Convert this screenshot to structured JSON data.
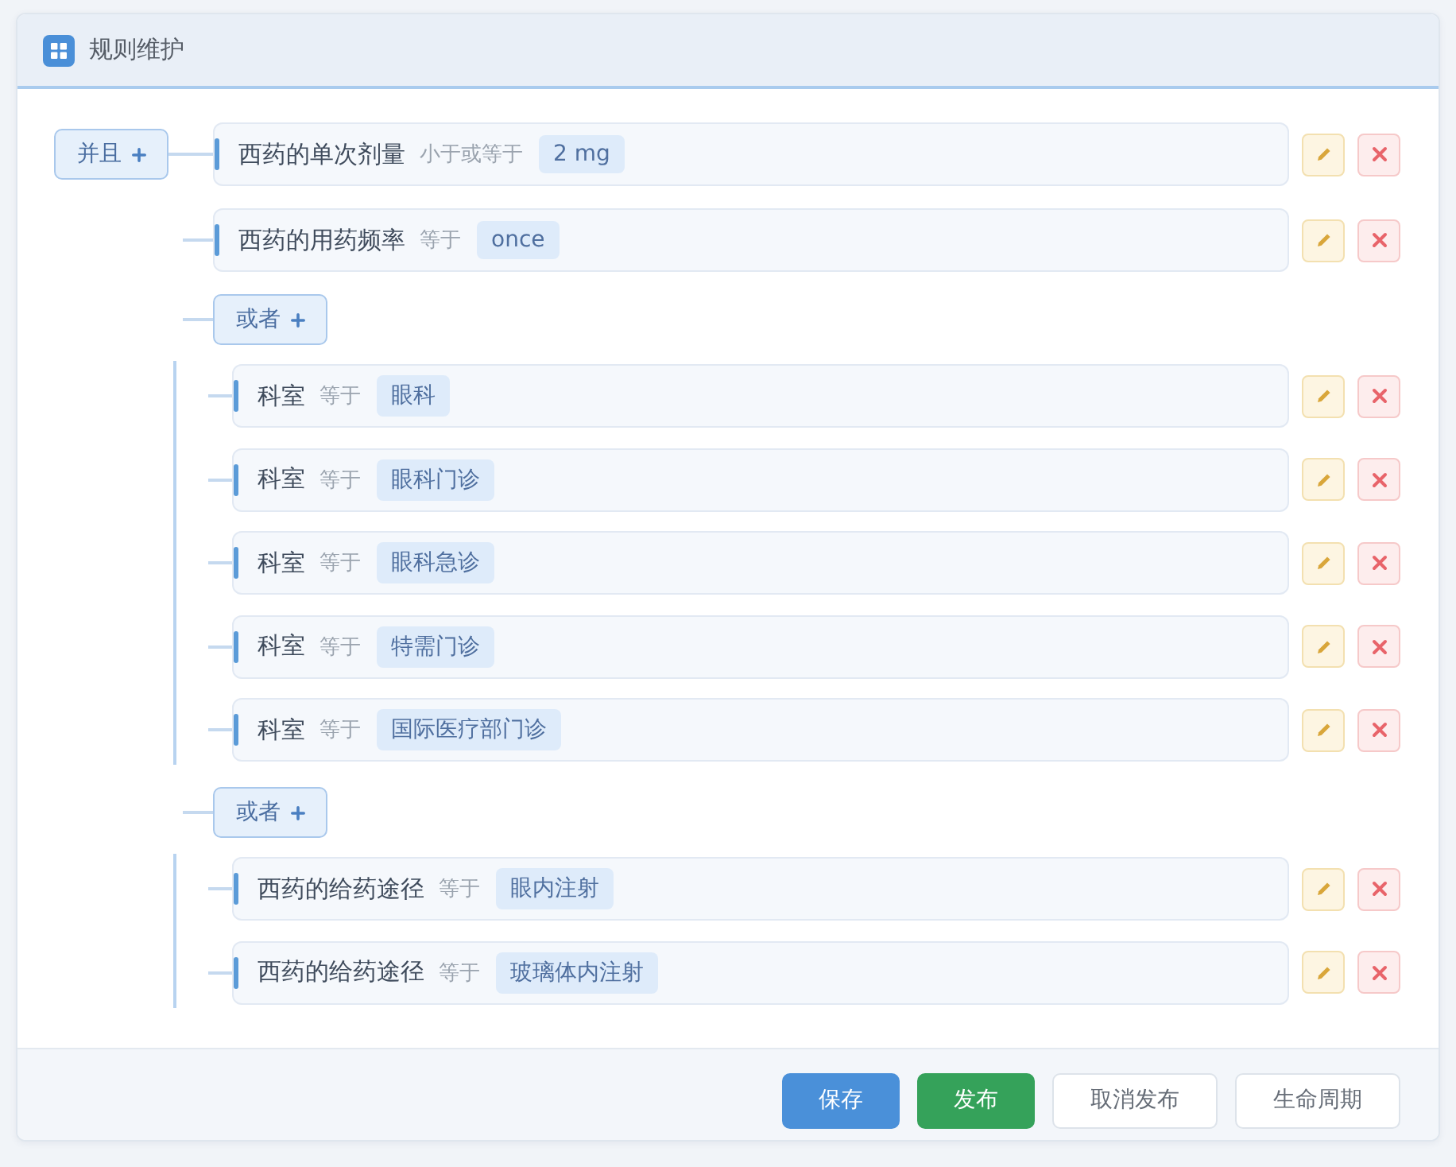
{
  "panel": {
    "title": "规则维护"
  },
  "rule_tree": {
    "operator": "并且",
    "children": [
      {
        "kind": "rule",
        "field": "西药的单次剂量",
        "operator": "小于或等于",
        "value": "2 mg"
      },
      {
        "kind": "rule",
        "field": "西药的用药频率",
        "operator": "等于",
        "value": "once"
      },
      {
        "kind": "group",
        "operator": "或者",
        "children": [
          {
            "field": "科室",
            "operator": "等于",
            "value": "眼科"
          },
          {
            "field": "科室",
            "operator": "等于",
            "value": "眼科门诊"
          },
          {
            "field": "科室",
            "operator": "等于",
            "value": "眼科急诊"
          },
          {
            "field": "科室",
            "operator": "等于",
            "value": "特需门诊"
          },
          {
            "field": "科室",
            "operator": "等于",
            "value": "国际医疗部门诊"
          }
        ]
      },
      {
        "kind": "group",
        "operator": "或者",
        "children": [
          {
            "field": "西药的给药途径",
            "operator": "等于",
            "value": "眼内注射"
          },
          {
            "field": "西药的给药途径",
            "operator": "等于",
            "value": "玻璃体内注射"
          }
        ]
      }
    ]
  },
  "footer_buttons": [
    {
      "label": "保存",
      "kind": "primary"
    },
    {
      "label": "发布",
      "kind": "success"
    },
    {
      "label": "取消发布",
      "kind": "default"
    },
    {
      "label": "生命周期",
      "kind": "default"
    }
  ]
}
